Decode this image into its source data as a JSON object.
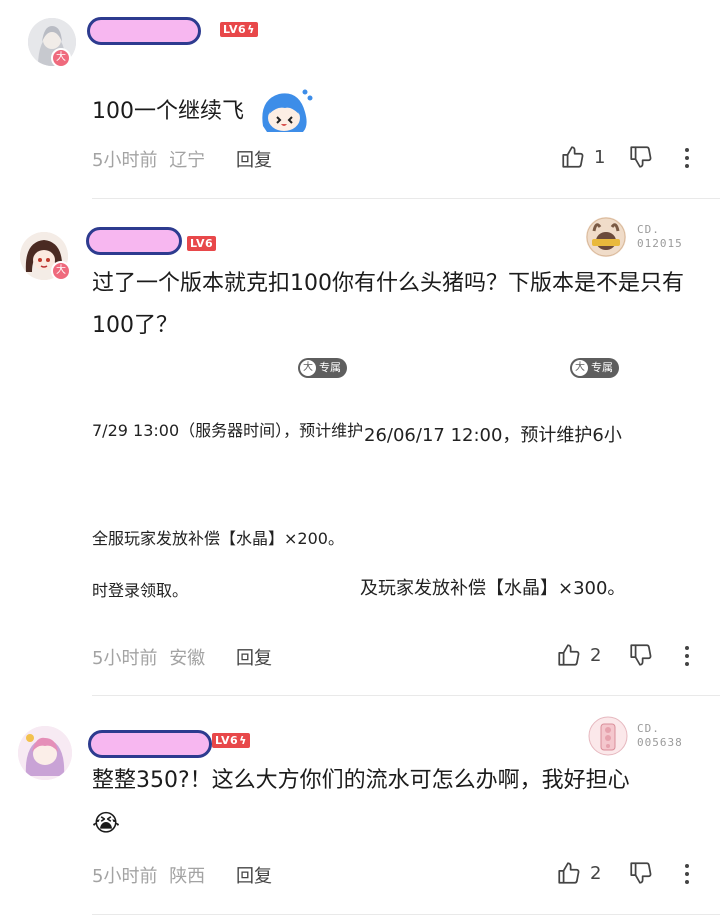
{
  "comments": [
    {
      "level": "LV6",
      "text": "100一个继续飞",
      "time": "5小时前",
      "location": "辽宁",
      "reply_label": "回复",
      "likes": "1",
      "avatar_badge": "大",
      "emoji": "blue-hair-sticker"
    },
    {
      "level": "LV6",
      "text": "过了一个版本就克扣100你有什么头猪吗？下版本是不是只有100了？",
      "time": "5小时前",
      "location": "安徽",
      "reply_label": "回复",
      "likes": "2",
      "avatar_badge": "大",
      "medal_code_1": "CD.",
      "medal_code_2": "012015",
      "exclusive_label": "专属",
      "exclusive_badge": "大",
      "screenshot_lines": {
        "left_1": "7/29 13:00（服务器时间），预计维护5",
        "right_1": "26/06/17 12:00，预计维护6小",
        "left_2": "全服玩家发放补偿【水晶】×200。",
        "left_3": "时登录领取。",
        "right_3": "及玩家发放补偿【水晶】×300。"
      }
    },
    {
      "level": "LV6",
      "text": "整整350?！这么大方你们的流水可怎么办啊，我好担心",
      "emoji_end": "😭",
      "time": "5小时前",
      "location": "陕西",
      "reply_label": "回复",
      "likes": "2",
      "medal_code_1": "CD.",
      "medal_code_2": "005638"
    }
  ],
  "colors": {
    "level_badge": "#e8484a",
    "redaction_fill": "#f7b7f0",
    "redaction_border": "#2d3b8f",
    "meta_text": "#a3a3a3"
  }
}
